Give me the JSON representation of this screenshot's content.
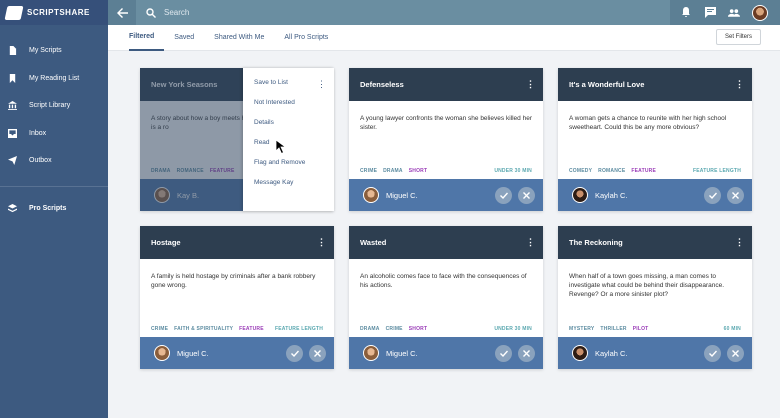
{
  "app": {
    "brand": "SCRIPTSHARE"
  },
  "sidebar": {
    "items": [
      {
        "label": "My Scripts",
        "icon": "file-icon"
      },
      {
        "label": "My Reading List",
        "icon": "bookmark-icon"
      },
      {
        "label": "Script Library",
        "icon": "library-icon"
      },
      {
        "label": "Inbox",
        "icon": "inbox-icon"
      },
      {
        "label": "Outbox",
        "icon": "send-icon"
      }
    ],
    "pro": {
      "label": "Pro Scripts",
      "icon": "layers-icon"
    }
  },
  "search": {
    "placeholder": "Search"
  },
  "tabs": [
    "Filtered",
    "Saved",
    "Shared With Me",
    "All Pro Scripts"
  ],
  "filter_button": "Set Filters",
  "menu": {
    "items": [
      "Save to List",
      "Not Interested",
      "Details",
      "Read",
      "Flag and Remove",
      "Message Kay"
    ]
  },
  "cards": [
    {
      "title": "New York Seasons",
      "logline": "A story about how a boy meets his brother more than far. It is a ro",
      "tags": [
        "DRAMA",
        "ROMANCE",
        "FEATURE"
      ],
      "highlight": 2,
      "length": "",
      "user": "Kay B."
    },
    {
      "title": "Defenseless",
      "logline": "A young lawyer confronts the woman she believes killed her sister.",
      "tags": [
        "CRIME",
        "DRAMA",
        "SHORT"
      ],
      "highlight": 2,
      "length": "UNDER 30 MIN",
      "user": "Miguel C."
    },
    {
      "title": "It's a Wonderful Love",
      "logline": "A woman gets a chance to reunite with her high school sweetheart. Could this be any more obvious?",
      "tags": [
        "COMEDY",
        "ROMANCE",
        "FEATURE"
      ],
      "highlight": 2,
      "length": "FEATURE LENGTH",
      "user": "Kaylah C."
    },
    {
      "title": "Hostage",
      "logline": "A family is held hostage by criminals after a bank robbery gone wrong.",
      "tags": [
        "CRIME",
        "FAITH & SPIRITUALITY",
        "FEATURE"
      ],
      "highlight": 2,
      "length": "FEATURE LENGTH",
      "user": "Miguel C."
    },
    {
      "title": "Wasted",
      "logline": "An alcoholic comes face to face with the consequences of his actions.",
      "tags": [
        "DRAMA",
        "CRIME",
        "SHORT"
      ],
      "highlight": 2,
      "length": "UNDER 30 MIN",
      "user": "Miguel C."
    },
    {
      "title": "The Reckoning",
      "logline": "When half of a town goes missing, a man comes to investigate what could be behind their disappearance. Revenge? Or a more sinister plot?",
      "tags": [
        "MYSTERY",
        "THRILLER",
        "PILOT"
      ],
      "highlight": 2,
      "length": "60 MIN",
      "user": "Kaylah C."
    }
  ],
  "colors": {
    "sidebar": "#3d5a80",
    "topbar": "#5c7f94",
    "card_head": "#2d3e50",
    "card_foot": "#4f76a8",
    "tag_highlight": "#9b3db8"
  }
}
